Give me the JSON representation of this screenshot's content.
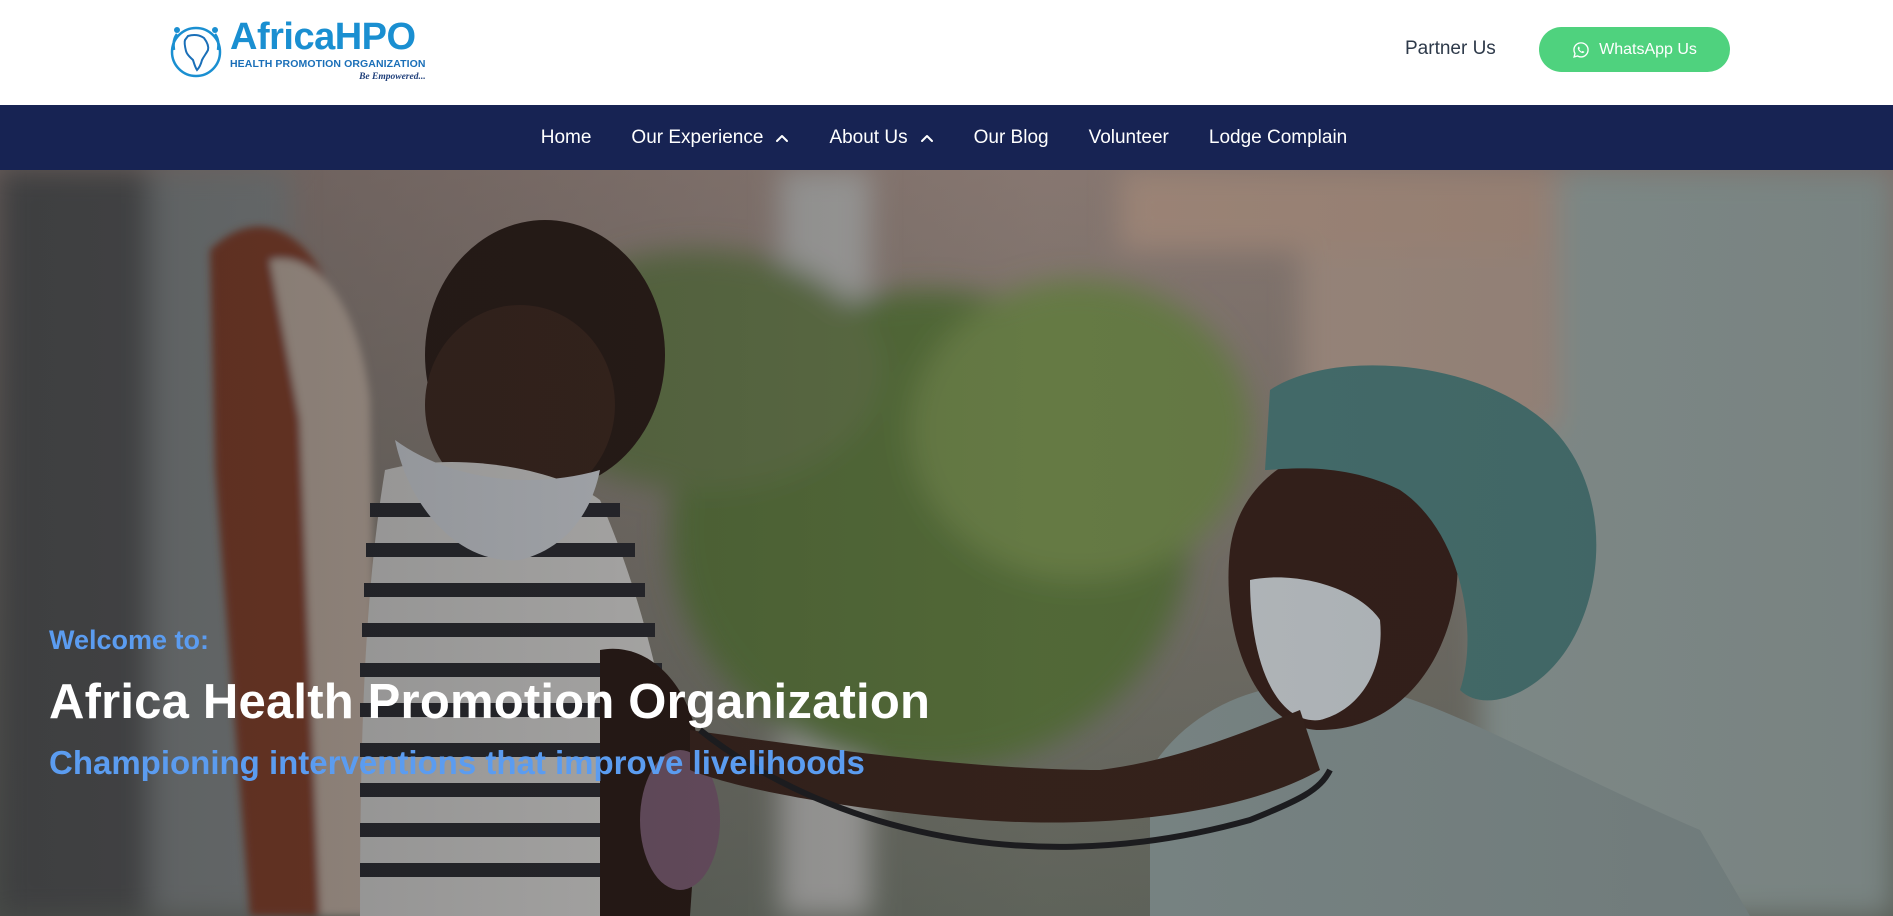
{
  "header": {
    "logo": {
      "name": "AfricaHPO",
      "subtitle": "HEALTH PROMOTION ORGANIZATION",
      "tagline": "Be Empowered..."
    },
    "partner_link": "Partner Us",
    "whatsapp_button": {
      "label": "WhatsApp Us",
      "icon": "whatsapp-icon",
      "color": "#4fd27e"
    }
  },
  "nav": {
    "background": "#172353",
    "items": [
      {
        "label": "Home",
        "has_dropdown": false
      },
      {
        "label": "Our Experience",
        "has_dropdown": true,
        "icon": "chevron-up-icon"
      },
      {
        "label": "About Us",
        "has_dropdown": true,
        "icon": "chevron-up-icon"
      },
      {
        "label": "Our Blog",
        "has_dropdown": false
      },
      {
        "label": "Volunteer",
        "has_dropdown": false
      },
      {
        "label": "Lodge Complain",
        "has_dropdown": false
      }
    ]
  },
  "hero": {
    "welcome": "Welcome to:",
    "title": "Africa Health Promotion Organization",
    "tagline": "Championing interventions that improve livelihoods",
    "accent_color": "#5b9cf0"
  }
}
